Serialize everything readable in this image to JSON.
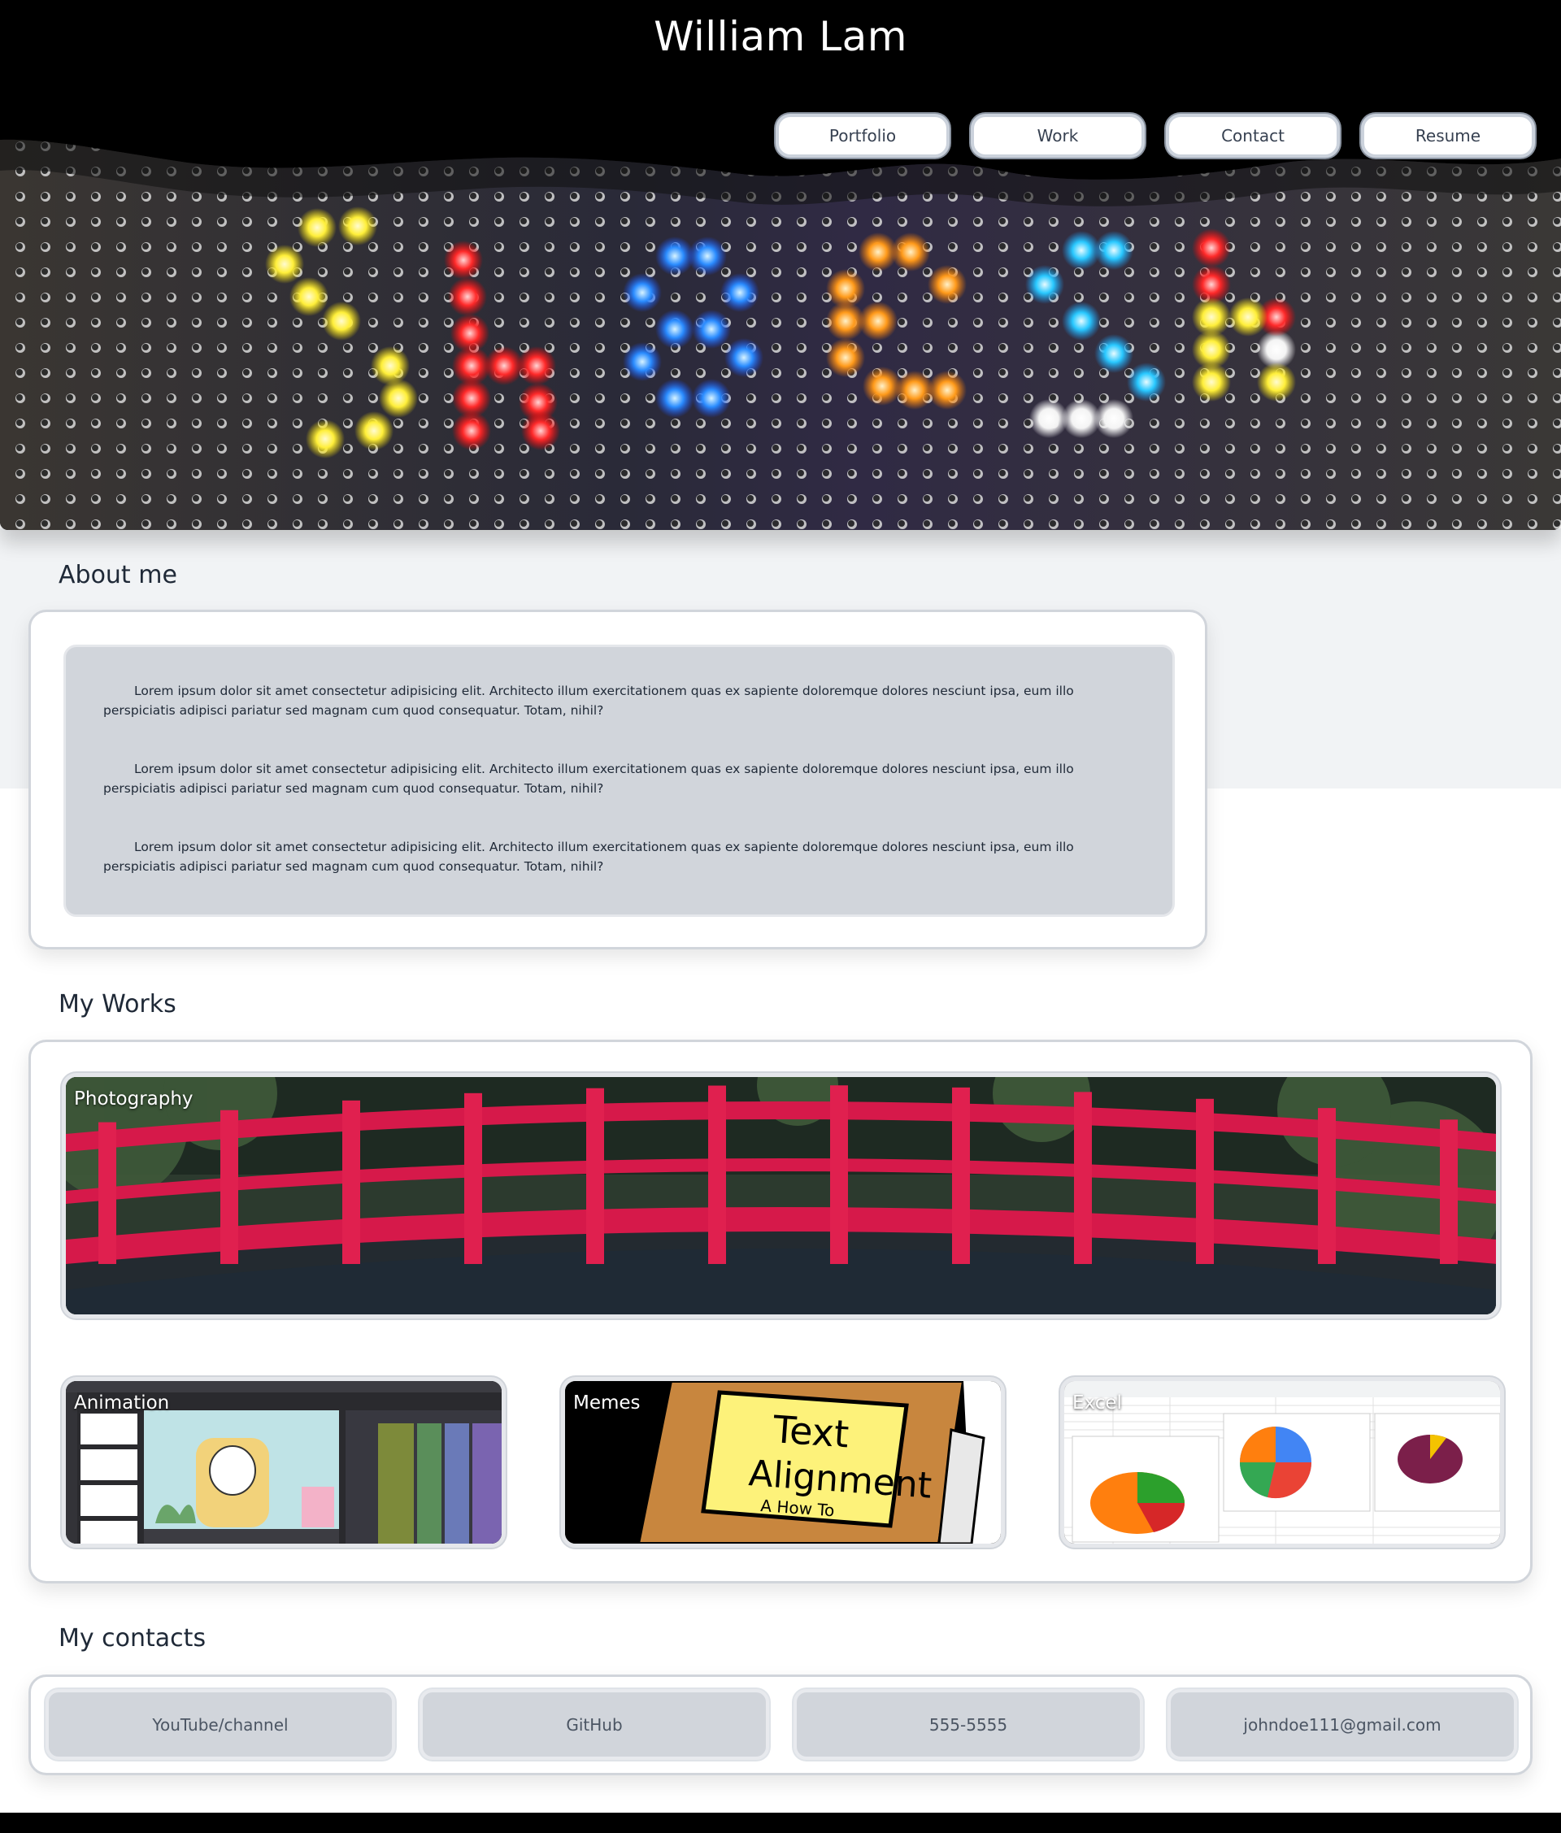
{
  "header": {
    "title": "William Lam",
    "nav": [
      {
        "label": "Portfolio"
      },
      {
        "label": "Work"
      },
      {
        "label": "Contact"
      },
      {
        "label": "Resume"
      }
    ],
    "hero_image": "led-pegboard-lights"
  },
  "about": {
    "heading": "About me",
    "paragraphs": [
      "Lorem ipsum dolor sit amet consectetur adipisicing elit. Architecto illum exercitationem quas ex sapiente doloremque dolores nesciunt ipsa, eum illo perspiciatis adipisci pariatur sed magnam cum quod consequatur. Totam, nihil?",
      "Lorem ipsum dolor sit amet consectetur adipisicing elit. Architecto illum exercitationem quas ex sapiente doloremque dolores nesciunt ipsa, eum illo perspiciatis adipisci pariatur sed magnam cum quod consequatur. Totam, nihil?",
      "Lorem ipsum dolor sit amet consectetur adipisicing elit. Architecto illum exercitationem quas ex sapiente doloremque dolores nesciunt ipsa, eum illo perspiciatis adipisci pariatur sed magnam cum quod consequatur. Totam, nihil?"
    ]
  },
  "works": {
    "heading": "My Works",
    "items": [
      {
        "label": "Photography",
        "image": "red-bridge-photo"
      },
      {
        "label": "Animation",
        "image": "animation-software-screenshot"
      },
      {
        "label": "Memes",
        "image": "text-alignment-book"
      },
      {
        "label": "Excel",
        "image": "spreadsheet-pie-charts"
      }
    ],
    "meme_text": {
      "line1": "Text",
      "line2": "Alignment",
      "line3": "A How To"
    }
  },
  "contacts": {
    "heading": "My contacts",
    "items": [
      {
        "label": "YouTube/channel"
      },
      {
        "label": "GitHub"
      },
      {
        "label": "555-5555"
      },
      {
        "label": "johndoe111@gmail.com"
      }
    ]
  },
  "colors": {
    "header_bg": "#000000",
    "card_border": "#d1d5db",
    "inner_bg": "#d1d5db",
    "band_bg": "#f1f3f5"
  }
}
